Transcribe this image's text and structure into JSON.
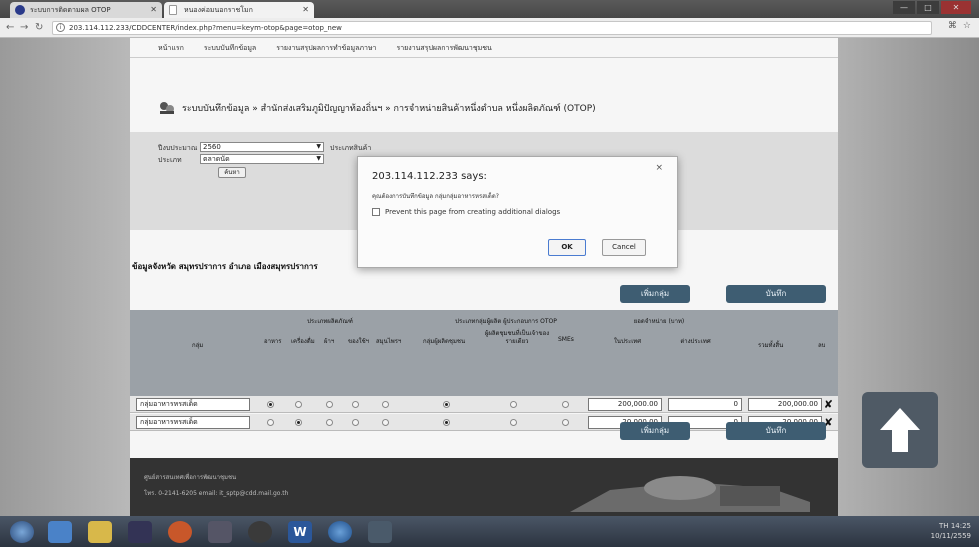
{
  "browser": {
    "tabs": [
      {
        "label": "ระบบการติดตามผล OTOP",
        "active": false
      },
      {
        "label": "หนองค่อมนอกราชโมก",
        "active": true
      }
    ],
    "url": "203.114.112.233/CDDCENTER/index.php?menu=keym-otop&page=otop_new",
    "window_controls": [
      "—",
      "□",
      "✕"
    ]
  },
  "page": {
    "nav": [
      "หน้าแรก",
      "ระบบบันทึกข้อมูล",
      "รายงานสรุปผลการทำข้อมูลภาษา",
      "รายงานสรุปผลการพัฒนาชุมชน"
    ],
    "breadcrumb": "ระบบบันทึกข้อมูล » สำนักส่งเสริมภูมิปัญญาท้องถิ่นฯ » การจำหน่ายสินค้าหนึ่งตำบล หนึ่งผลิตภัณฑ์ (OTOP)",
    "filter": {
      "year_label": "ปีงบประมาณ",
      "year_value": "2560",
      "type_label": "ประเภท",
      "type_value": "ตลาดนัด",
      "search_button": "ค้นหา",
      "extra_label": "ประเภทสินค้า"
    },
    "section_title": "ข้อมูลจังหวัด สมุทรปราการ อำเภอ เมืองสมุทรปราการ",
    "add_group_button": "เพิ่มกลุ่ม",
    "save_button": "บันทึก",
    "table": {
      "col_group": "กลุ่ม",
      "product_type_header": "ประเภทผลิตภัณฑ์",
      "product_types": [
        "อาหาร",
        "เครื่องดื่ม",
        "ผ้าฯ",
        "ของใช้ฯ",
        "สมุนไพรฯ"
      ],
      "entity_header": "ประเภทกลุ่มผู้ผลิต ผู้ประกอบการ OTOP",
      "entity_types": [
        "กลุ่มผู้ผลิตชุมชน",
        "ผู้ผลิตชุมชนที่เป็นเจ้าของรายเดียว",
        "SMEs"
      ],
      "sales_header": "ยอดจำหน่าย (บาท)",
      "sales_cols": [
        "ในประเทศ",
        "ต่างประเทศ"
      ],
      "total_header": "รวมทั้งสิ้น",
      "del_header": "ลบ",
      "rows": [
        {
          "group": "กลุ่มอาหารหรสเด็ด",
          "product_type_index": 0,
          "entity_index": 0,
          "domestic": "200,000.00",
          "foreign": "0",
          "total": "200,000.00"
        },
        {
          "group": "กลุ่มอาหารหรสเด็ด",
          "product_type_index": 1,
          "entity_index": 0,
          "domestic": "20,000.00",
          "foreign": "0",
          "total": "20,000.00"
        }
      ],
      "delete_glyph": "✘"
    },
    "footer": {
      "line1": "ศูนย์สารสนเทศเพื่อการพัฒนาชุมชน",
      "line2": "โทร. 0-2141-6205 email: it_sptp@cdd.mail.go.th"
    }
  },
  "dialog": {
    "title": "203.114.112.233 says:",
    "message": "คุณต้องการบันทึกข้อมูล กลุ่มกลุ่มอาหารหรสเด็ด?",
    "checkbox_label": "Prevent this page from creating additional dialogs",
    "ok": "OK",
    "cancel": "Cancel",
    "close": "×"
  },
  "taskbar": {
    "time": "14:25",
    "date": "10/11/2559",
    "lang": "TH"
  },
  "colors": {
    "accent_button": "#3e5d72",
    "table_header": "#9ba1a7",
    "taskbar": "#2c3440"
  }
}
